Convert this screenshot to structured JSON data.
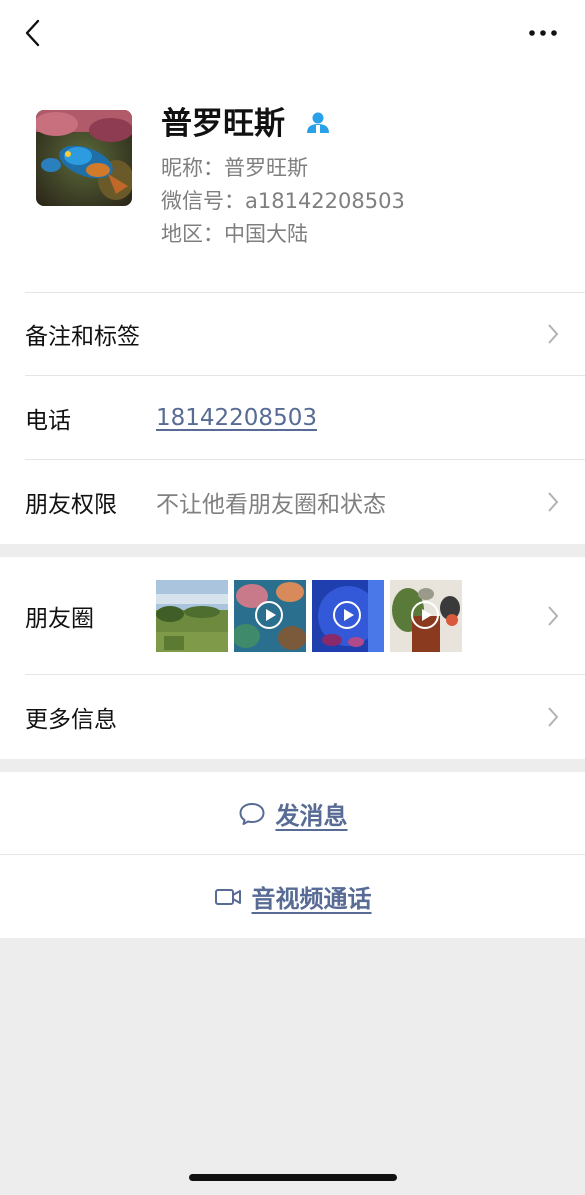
{
  "profile": {
    "name": "普罗旺斯",
    "nickname_label": "昵称：",
    "nickname": "普罗旺斯",
    "wechat_label": "微信号：",
    "wechat_id": "a18142208503",
    "region_label": "地区：",
    "region": "中国大陆"
  },
  "rows": {
    "remarks": "备注和标签",
    "phone_label": "电话",
    "phone": "18142208503",
    "permission_label": "朋友权限",
    "permission_value": "不让他看朋友圈和状态",
    "moments_label": "朋友圈",
    "more_label": "更多信息"
  },
  "actions": {
    "message": "发消息",
    "call": "音视频通话"
  },
  "colors": {
    "link": "#576b95",
    "background": "#ededed",
    "badge": "#2aa0e8"
  },
  "icons": {
    "back": "back-chevron-icon",
    "more": "more-dots-icon",
    "contact": "person-icon",
    "chat": "chat-bubble-icon",
    "video": "video-camera-icon"
  }
}
